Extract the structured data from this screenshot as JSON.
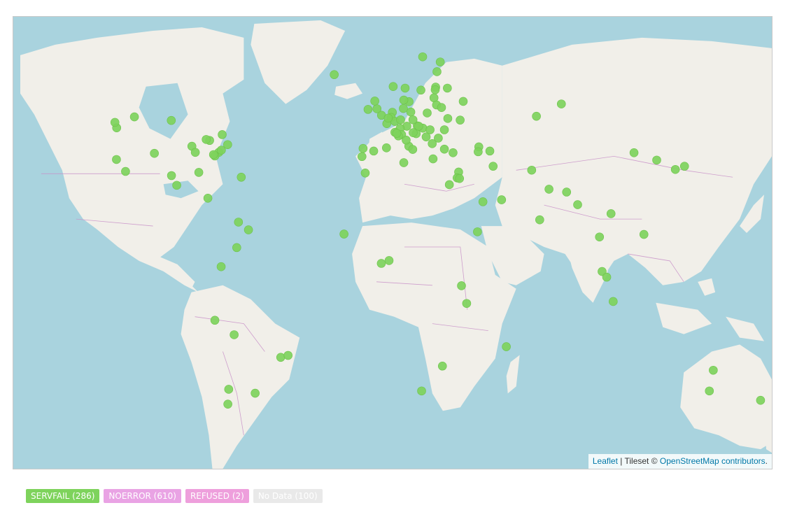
{
  "map": {
    "attribution": {
      "leaflet_label": "Leaflet",
      "separator": " | ",
      "tileset_prefix": "Tileset © ",
      "osm_label": "OpenStreetMap contributors",
      "suffix": "."
    },
    "marker_color": "#7ed35c",
    "ocean_color": "#a9d3de",
    "land_color": "#f1efe9",
    "border_color": "#c88fc8",
    "markers": [
      {
        "lon": -122.4,
        "lat": 37.8
      },
      {
        "lon": -118.2,
        "lat": 34.1
      },
      {
        "lon": -122.3,
        "lat": 47.6
      },
      {
        "lon": -123.1,
        "lat": 49.3
      },
      {
        "lon": -114.1,
        "lat": 51.0
      },
      {
        "lon": -104.9,
        "lat": 39.7
      },
      {
        "lon": -97.0,
        "lat": 32.8
      },
      {
        "lon": -94.6,
        "lat": 29.8
      },
      {
        "lon": -87.6,
        "lat": 41.9
      },
      {
        "lon": -84.4,
        "lat": 33.8
      },
      {
        "lon": -79.4,
        "lat": 43.7
      },
      {
        "lon": -75.2,
        "lat": 40.0
      },
      {
        "lon": -74.0,
        "lat": 40.7
      },
      {
        "lon": -77.0,
        "lat": 38.9
      },
      {
        "lon": -71.1,
        "lat": 42.4
      },
      {
        "lon": -73.6,
        "lat": 45.5
      },
      {
        "lon": -80.2,
        "lat": 25.8
      },
      {
        "lon": -64.8,
        "lat": 32.3
      },
      {
        "lon": -66.1,
        "lat": 18.4
      },
      {
        "lon": -61.5,
        "lat": 16.0
      },
      {
        "lon": -81.0,
        "lat": 44.0
      },
      {
        "lon": -86.0,
        "lat": 40.0
      },
      {
        "lon": -97.1,
        "lat": 49.9
      },
      {
        "lon": -77.6,
        "lat": 39.3
      },
      {
        "lon": -74.1,
        "lat": 4.6
      },
      {
        "lon": -66.9,
        "lat": 10.5
      },
      {
        "lon": -77.0,
        "lat": -12.0
      },
      {
        "lon": -68.1,
        "lat": -16.5
      },
      {
        "lon": -46.6,
        "lat": -23.5
      },
      {
        "lon": -43.2,
        "lat": -22.9
      },
      {
        "lon": -58.4,
        "lat": -34.6
      },
      {
        "lon": -70.6,
        "lat": -33.4
      },
      {
        "lon": -71.0,
        "lat": -38.0
      },
      {
        "lon": -9.1,
        "lat": 38.7
      },
      {
        "lon": -8.6,
        "lat": 41.2
      },
      {
        "lon": -3.7,
        "lat": 40.4
      },
      {
        "lon": 2.2,
        "lat": 41.4
      },
      {
        "lon": -6.3,
        "lat": 53.3
      },
      {
        "lon": -0.1,
        "lat": 51.5
      },
      {
        "lon": -2.2,
        "lat": 53.5
      },
      {
        "lon": -3.2,
        "lat": 55.9
      },
      {
        "lon": 2.35,
        "lat": 48.9
      },
      {
        "lon": 4.9,
        "lat": 52.4
      },
      {
        "lon": 4.4,
        "lat": 50.8
      },
      {
        "lon": 6.1,
        "lat": 49.6
      },
      {
        "lon": 8.7,
        "lat": 50.1
      },
      {
        "lon": 13.4,
        "lat": 52.5
      },
      {
        "lon": 10.0,
        "lat": 53.6
      },
      {
        "lon": 11.6,
        "lat": 48.1
      },
      {
        "lon": 8.5,
        "lat": 47.4
      },
      {
        "lon": 6.1,
        "lat": 46.2
      },
      {
        "lon": 16.4,
        "lat": 48.2
      },
      {
        "lon": 14.4,
        "lat": 50.1
      },
      {
        "lon": 19.0,
        "lat": 47.5
      },
      {
        "lon": 21.0,
        "lat": 52.2
      },
      {
        "lon": 12.5,
        "lat": 41.9
      },
      {
        "lon": 9.2,
        "lat": 45.5
      },
      {
        "lon": 7.7,
        "lat": 45.1
      },
      {
        "lon": 14.3,
        "lat": 40.9
      },
      {
        "lon": 23.7,
        "lat": 38.0
      },
      {
        "lon": 26.1,
        "lat": 44.4
      },
      {
        "lon": 23.3,
        "lat": 42.7
      },
      {
        "lon": 20.5,
        "lat": 44.8
      },
      {
        "lon": 15.9,
        "lat": 45.8
      },
      {
        "lon": 14.5,
        "lat": 46.1
      },
      {
        "lon": 17.1,
        "lat": 48.1
      },
      {
        "lon": 12.6,
        "lat": 55.7
      },
      {
        "lon": 10.2,
        "lat": 56.2
      },
      {
        "lon": 18.1,
        "lat": 59.3
      },
      {
        "lon": 10.8,
        "lat": 59.9
      },
      {
        "lon": 5.3,
        "lat": 60.4
      },
      {
        "lon": 24.9,
        "lat": 60.2
      },
      {
        "lon": 25.5,
        "lat": 65.0
      },
      {
        "lon": 18.9,
        "lat": 69.6
      },
      {
        "lon": 27.0,
        "lat": 68.0
      },
      {
        "lon": 24.1,
        "lat": 56.9
      },
      {
        "lon": 25.3,
        "lat": 54.7
      },
      {
        "lon": 24.7,
        "lat": 59.4
      },
      {
        "lon": 27.6,
        "lat": 53.9
      },
      {
        "lon": 30.5,
        "lat": 50.5
      },
      {
        "lon": 28.9,
        "lat": 47.0
      },
      {
        "lon": 30.3,
        "lat": 59.9
      },
      {
        "lon": 37.6,
        "lat": 55.8
      },
      {
        "lon": 36.2,
        "lat": 50.0
      },
      {
        "lon": 28.9,
        "lat": 41.0
      },
      {
        "lon": 32.9,
        "lat": 39.9
      },
      {
        "lon": 35.5,
        "lat": 33.9
      },
      {
        "lon": 34.8,
        "lat": 32.1
      },
      {
        "lon": 35.9,
        "lat": 31.9
      },
      {
        "lon": 44.8,
        "lat": 41.7
      },
      {
        "lon": 44.5,
        "lat": 40.2
      },
      {
        "lon": 49.9,
        "lat": 40.4
      },
      {
        "lon": 51.4,
        "lat": 35.7
      },
      {
        "lon": 46.7,
        "lat": 24.7
      },
      {
        "lon": 55.3,
        "lat": 25.3
      },
      {
        "lon": 44.2,
        "lat": 15.4
      },
      {
        "lon": 69.2,
        "lat": 34.5
      },
      {
        "lon": 71.4,
        "lat": 51.2
      },
      {
        "lon": 77.2,
        "lat": 28.6
      },
      {
        "lon": 72.9,
        "lat": 19.1
      },
      {
        "lon": 90.4,
        "lat": 23.8
      },
      {
        "lon": 85.3,
        "lat": 27.7
      },
      {
        "lon": 100.5,
        "lat": 13.8
      },
      {
        "lon": 105.8,
        "lat": 21.0
      },
      {
        "lon": 101.7,
        "lat": 3.1
      },
      {
        "lon": 103.8,
        "lat": 1.35
      },
      {
        "lon": 106.8,
        "lat": -6.2
      },
      {
        "lon": 121.0,
        "lat": 14.6
      },
      {
        "lon": 116.4,
        "lat": 39.9
      },
      {
        "lon": 126.9,
        "lat": 37.6
      },
      {
        "lon": 139.7,
        "lat": 35.7
      },
      {
        "lon": 135.5,
        "lat": 34.7
      },
      {
        "lon": 82.9,
        "lat": 55.0
      },
      {
        "lon": 151.2,
        "lat": -33.9
      },
      {
        "lon": 153.0,
        "lat": -27.5
      },
      {
        "lon": 174.8,
        "lat": -36.8
      },
      {
        "lon": 18.4,
        "lat": -33.9
      },
      {
        "lon": 28.0,
        "lat": -26.2
      },
      {
        "lon": 36.8,
        "lat": -1.3
      },
      {
        "lon": 39.2,
        "lat": -6.8
      },
      {
        "lon": 3.4,
        "lat": 6.5
      },
      {
        "lon": -0.2,
        "lat": 5.6
      },
      {
        "lon": -17.4,
        "lat": 14.7
      },
      {
        "lon": 31.2,
        "lat": 30.0
      },
      {
        "lon": 10.2,
        "lat": 36.8
      },
      {
        "lon": -7.6,
        "lat": 33.6
      },
      {
        "lon": 57.5,
        "lat": -20.2
      },
      {
        "lon": -21.9,
        "lat": 64.1
      },
      {
        "lon": 6.9,
        "lat": 45.9
      },
      {
        "lon": 3.0,
        "lat": 50.6
      },
      {
        "lon": 11.3,
        "lat": 43.8
      },
      {
        "lon": 22.3,
        "lat": 47.0
      }
    ]
  },
  "legend": [
    {
      "label": "SERVFAIL (286)",
      "color": "#7ed35c"
    },
    {
      "label": "NOERROR (610)",
      "color": "#e9a3e4"
    },
    {
      "label": "REFUSED (2)",
      "color": "#ee9fdc"
    },
    {
      "label": "No Data (100)",
      "color": "#e9e9e9"
    }
  ]
}
